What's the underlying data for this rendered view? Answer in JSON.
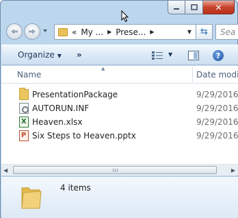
{
  "window": {
    "caption": {
      "minimize_icon": "minimize-icon",
      "maximize_icon": "maximize-icon",
      "close_glyph": "✕"
    }
  },
  "address_bar": {
    "chevrons": "«",
    "crumbs": [
      "My ...",
      "Prese..."
    ],
    "search_placeholder": "Sea",
    "refresh_glyph": "⇆"
  },
  "toolbar": {
    "organize_label": "Organize",
    "overflow_label": "»",
    "help_glyph": "?"
  },
  "columns": {
    "name": "Name",
    "date": "Date modi"
  },
  "files": [
    {
      "name": "PresentationPackage",
      "date": "9/29/2016",
      "icon": "folder-icon"
    },
    {
      "name": "AUTORUN.INF",
      "date": "9/29/2016",
      "icon": "inf-file-icon"
    },
    {
      "name": "Heaven.xlsx",
      "date": "9/29/2016",
      "icon": "excel-file-icon"
    },
    {
      "name": "Six Steps to Heaven.pptx",
      "date": "9/29/2016",
      "icon": "powerpoint-file-icon"
    }
  ],
  "details": {
    "item_count": "4 items"
  },
  "colors": {
    "accent": "#2a6cb5",
    "frame": "#bcd6ee",
    "close": "#c7432b"
  }
}
